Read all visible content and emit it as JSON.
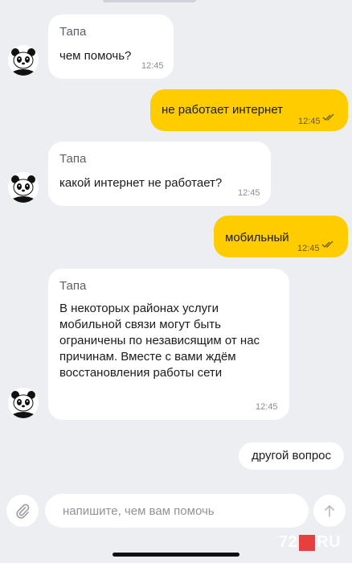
{
  "bot": {
    "name": "Тапа"
  },
  "messages": [
    {
      "side": "in",
      "text": "чем помочь?",
      "time": "12:45"
    },
    {
      "side": "out",
      "text": "не работает интернет",
      "time": "12:45"
    },
    {
      "side": "in",
      "text": "какой интернет не работает?",
      "time": "12:45"
    },
    {
      "side": "out",
      "text": "мобильный",
      "time": "12:45"
    },
    {
      "side": "in",
      "text": "В некоторых районах услуги мобильной связи могут быть ограничены по независящим от нас причинам. Вместе с вами ждём восстановления работы сети",
      "time": "12:45"
    }
  ],
  "quick_reply": "другой вопрос",
  "input": {
    "placeholder": "напишите, чем вам помочь",
    "value": ""
  },
  "watermark": {
    "left": "72",
    "right": "RU"
  },
  "icons": {
    "attach": "paperclip-icon",
    "send": "arrow-up-icon",
    "read": "double-check-icon",
    "avatar": "panda-icon"
  },
  "colors": {
    "outgoing": "#ffcc00",
    "incoming": "#ffffff",
    "background": "#eceef2"
  }
}
